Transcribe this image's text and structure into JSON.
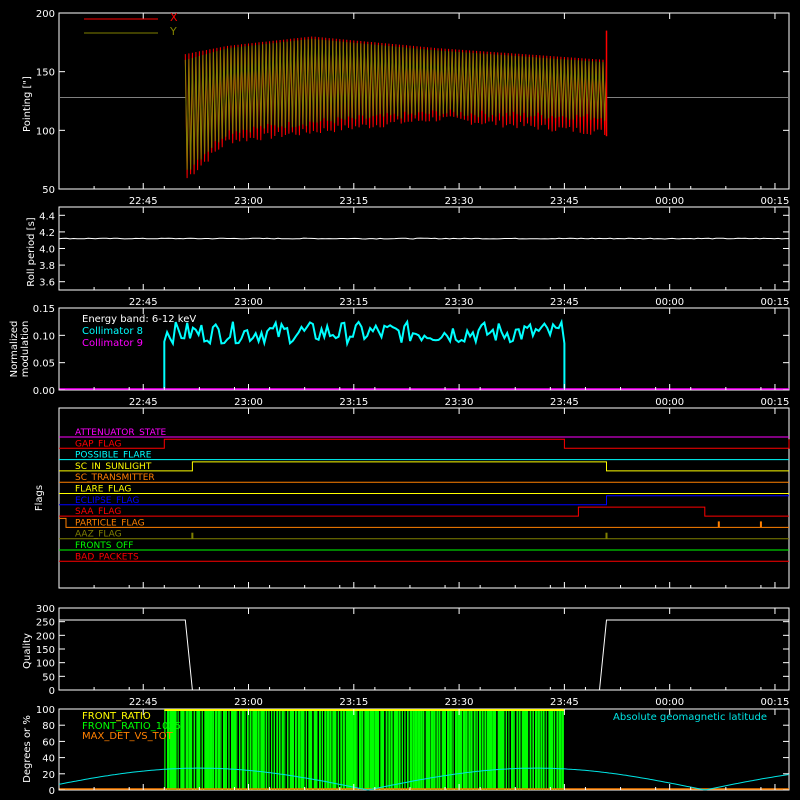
{
  "colors": {
    "background": "#000000",
    "axis": "#ffffff",
    "x_series": "#ff0000",
    "y_series": "#808000",
    "collimator8": "#00ffff",
    "collimator9": "#ff00ff",
    "quality": "#ffffff",
    "geomag": "#00e5e5",
    "front_ratio": "#ffff00",
    "front_ratio_2": "#00ff00",
    "max_det": "#ff8000"
  },
  "time_ticks": [
    "22:45",
    "23:00",
    "23:15",
    "23:30",
    "23:45",
    "00:00",
    "00:15"
  ],
  "chart_data": [
    {
      "id": "pointing",
      "type": "line",
      "ylabel": "Pointing [\"]",
      "ylim": [
        50,
        200
      ],
      "yticks": [
        "50",
        "100",
        "150",
        "200"
      ],
      "ytick_values": [
        50,
        100,
        150,
        200
      ],
      "legend_position": "top-left",
      "baseline": 128,
      "series": [
        {
          "name": "X",
          "color": "#ff0000",
          "segment": [
            "22:51",
            "23:51"
          ],
          "upper": [
            [
              0,
              165
            ],
            [
              0.1,
              172
            ],
            [
              0.3,
              180
            ],
            [
              0.6,
              170
            ],
            [
              1,
              160
            ]
          ],
          "lower": [
            [
              0,
              55
            ],
            [
              0.1,
              88
            ],
            [
              0.3,
              96
            ],
            [
              0.6,
              107
            ],
            [
              1,
              95
            ]
          ]
        },
        {
          "name": "Y",
          "color": "#808000",
          "segment": [
            "22:51",
            "23:51"
          ],
          "upper": [
            [
              0,
              160
            ],
            [
              0.1,
              170
            ],
            [
              0.3,
              178
            ],
            [
              0.6,
              168
            ],
            [
              1,
              158
            ]
          ],
          "lower": [
            [
              0,
              62
            ],
            [
              0.1,
              96
            ],
            [
              0.3,
              104
            ],
            [
              0.6,
              112
            ],
            [
              1,
              108
            ]
          ]
        }
      ]
    },
    {
      "id": "roll",
      "type": "line",
      "ylabel": "Roll period [s]",
      "ylim": [
        3.5,
        4.5
      ],
      "yticks": [
        "3.6",
        "3.8",
        "4.0",
        "4.2",
        "4.4"
      ],
      "ytick_values": [
        3.6,
        3.8,
        4.0,
        4.2,
        4.4
      ],
      "series": [
        {
          "name": "",
          "color": "#ffffff",
          "y": 4.12
        }
      ]
    },
    {
      "id": "modulation",
      "type": "line",
      "ylabel": "Normalized modulation",
      "ylabel_lines": [
        "Normalized",
        "modulation"
      ],
      "ylim": [
        0,
        0.15
      ],
      "yticks": [
        "0.00",
        "0.05",
        "0.10",
        "0.15"
      ],
      "ytick_values": [
        0,
        0.05,
        0.1,
        0.15
      ],
      "energy_band": "Energy band: 6-12 keV",
      "series": [
        {
          "name": "Collimator 8",
          "color": "#00ffff",
          "segment": [
            "22:48",
            "23:45"
          ],
          "mean": 0.105,
          "spread": 0.02
        },
        {
          "name": "Collimator 9",
          "color": "#ff00ff",
          "y": 0
        }
      ]
    },
    {
      "id": "flags",
      "type": "line",
      "ylabel": "Flags",
      "series": [
        {
          "name": "ATTENUATOR_STATE",
          "color": "#ff00ff",
          "steps": []
        },
        {
          "name": "GAP_FLAG",
          "color": "#ff0000",
          "steps": [
            [
              "22:48",
              1
            ],
            [
              "23:45",
              0
            ],
            [
              "end",
              1
            ]
          ]
        },
        {
          "name": "POSSIBLE_FLARE",
          "color": "#00ffff",
          "steps": []
        },
        {
          "name": "SC_IN_SUNLIGHT",
          "color": "#ffff00",
          "steps": [
            [
              "22:52",
              1
            ],
            [
              "23:51",
              0
            ]
          ]
        },
        {
          "name": "SC_TRANSMITTER",
          "color": "#ff8000",
          "steps": []
        },
        {
          "name": "FLARE_FLAG",
          "color": "#ffff00",
          "steps": []
        },
        {
          "name": "ECLIPSE_FLAG",
          "color": "#0000ff",
          "steps": [
            [
              "22:52",
              0
            ],
            [
              "23:51",
              1
            ]
          ]
        },
        {
          "name": "SAA_FLAG",
          "color": "#ff0000",
          "steps": [
            [
              "23:47",
              1
            ],
            [
              "00:05",
              0
            ]
          ]
        },
        {
          "name": "PARTICLE_FLAG",
          "color": "#ff8000",
          "steps": [
            [
              "start",
              1
            ],
            [
              "22:34",
              0
            ]
          ],
          "spikes": [
            "00:07",
            "00:13"
          ]
        },
        {
          "name": "AAZ_FLAG",
          "color": "#808000",
          "steps": [],
          "spikes": [
            "22:52",
            "23:51"
          ]
        },
        {
          "name": "FRONTS_OFF",
          "color": "#00ff00",
          "steps": []
        },
        {
          "name": "BAD_PACKETS",
          "color": "#ff0000",
          "steps": []
        }
      ]
    },
    {
      "id": "quality",
      "type": "line",
      "ylabel": "Quality",
      "ylim": [
        0,
        300
      ],
      "yticks": [
        "0",
        "50",
        "100",
        "150",
        "200",
        "250",
        "300"
      ],
      "ytick_values": [
        0,
        50,
        100,
        150,
        200,
        250,
        300
      ],
      "series": [
        {
          "name": "",
          "color": "#ffffff",
          "points": [
            [
              "start",
              256
            ],
            [
              "22:51",
              256
            ],
            [
              "22:52",
              0
            ],
            [
              "23:50",
              0
            ],
            [
              "23:51",
              256
            ],
            [
              "end",
              256
            ]
          ]
        }
      ]
    },
    {
      "id": "ratios",
      "type": "bar",
      "ylabel": "Degrees or %",
      "ylim": [
        0,
        100
      ],
      "yticks": [
        "0",
        "20",
        "40",
        "60",
        "80",
        "100"
      ],
      "ytick_values": [
        0,
        20,
        40,
        60,
        80,
        100
      ],
      "legend_right": "Absolute geomagnetic latitude",
      "series": [
        {
          "name": "FRONT_RATIO",
          "color": "#ffff00",
          "segment": [
            "22:48",
            "23:45"
          ]
        },
        {
          "name": "FRONT_RATIO_1025",
          "color": "#00ff00",
          "segment": [
            "22:48",
            "23:45"
          ]
        },
        {
          "name": "MAX_DET_VS_TOT",
          "color": "#ff8000",
          "segment": [
            "22:48",
            "23:45"
          ]
        },
        {
          "name": "Absolute geomagnetic latitude",
          "color": "#00e5e5",
          "minima": [
            "23:17",
            "00:05"
          ],
          "maxima": [
            "22:56",
            "23:47"
          ],
          "range": [
            0,
            27
          ]
        }
      ]
    }
  ]
}
